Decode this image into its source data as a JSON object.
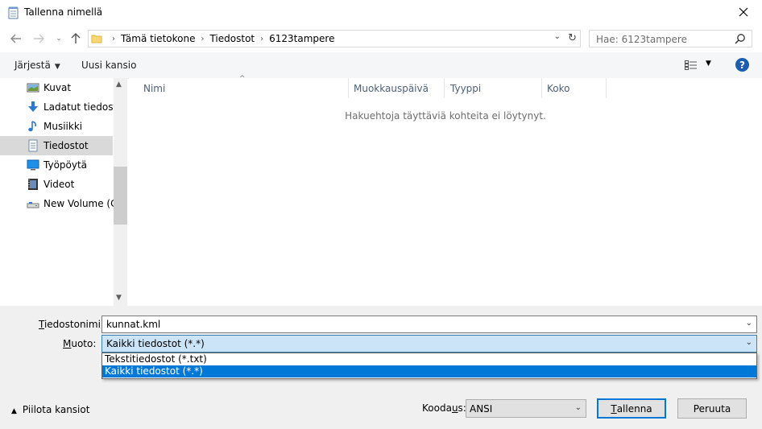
{
  "window": {
    "title": "Tallenna nimellä"
  },
  "address": {
    "crumbs": [
      "Tämä tietokone",
      "Tiedostot",
      "6123tampere"
    ],
    "search_placeholder": "Hae: 6123tampere"
  },
  "toolbar": {
    "organize": "Järjestä",
    "new_folder": "Uusi kansio"
  },
  "nav": {
    "items": [
      {
        "label": "Kuvat",
        "icon": "pictures-icon"
      },
      {
        "label": "Ladatut tiedosto",
        "icon": "downloads-icon"
      },
      {
        "label": "Musiikki",
        "icon": "music-icon"
      },
      {
        "label": "Tiedostot",
        "icon": "documents-icon",
        "selected": true
      },
      {
        "label": "Työpöytä",
        "icon": "desktop-icon"
      },
      {
        "label": "Videot",
        "icon": "videos-icon"
      },
      {
        "label": "New Volume (C:",
        "icon": "drive-icon"
      }
    ]
  },
  "filelist": {
    "columns": [
      "Nimi",
      "Muokkauspäivä",
      "Tyyppi",
      "Koko"
    ],
    "empty_message": "Hakuehtoja täyttäviä kohteita ei löytynyt."
  },
  "form": {
    "filename_label_u": "T",
    "filename_label_rest": "iedostonimi:",
    "filename_value": "kunnat.kml",
    "type_label_u": "M",
    "type_label_rest": "uoto:",
    "type_value": "Kaikki tiedostot  (*.*)",
    "type_options": [
      "Tekstitiedostot (*.txt)",
      "Kaikki tiedostot  (*.*)"
    ],
    "type_selected_index": 1,
    "hide_folders": "Piilota kansiot",
    "encoding_label_pre": "Kooda",
    "encoding_label_u": "u",
    "encoding_label_post": "s:",
    "encoding_value": "ANSI",
    "save_u": "T",
    "save_rest": "allenna",
    "cancel": "Peruuta"
  }
}
